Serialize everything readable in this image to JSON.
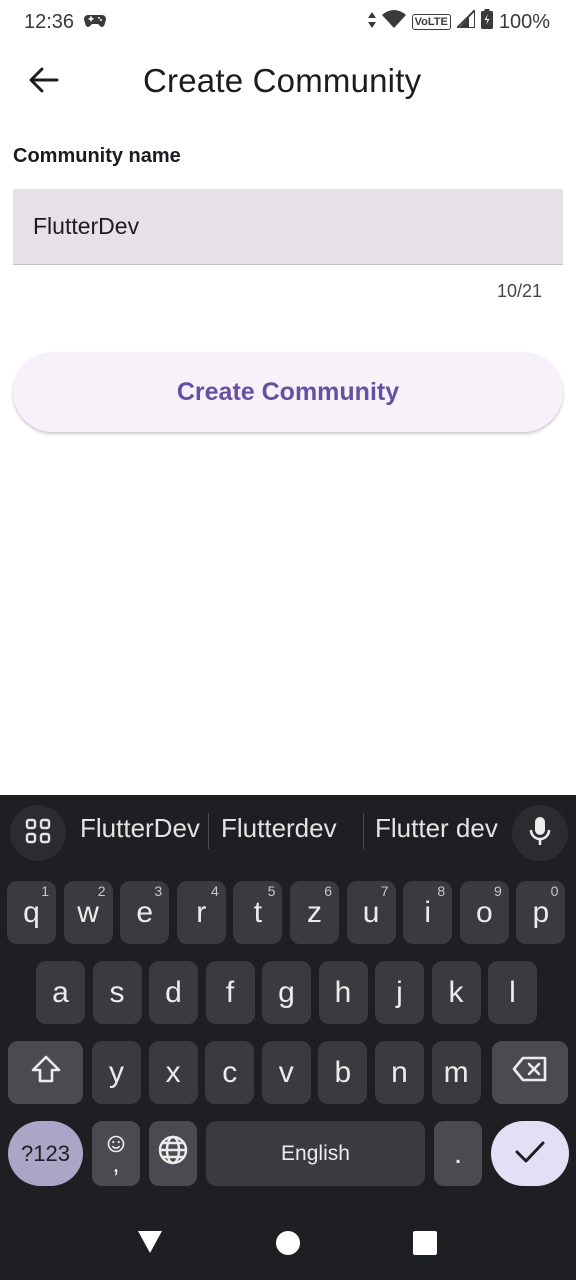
{
  "status_bar": {
    "time": "12:36",
    "volte": "VoLTE",
    "battery": "100%"
  },
  "app_bar": {
    "title": "Create Community",
    "back_icon": "arrow-left-icon"
  },
  "form": {
    "label": "Community name",
    "input_value": "FlutterDev",
    "counter": "10/21",
    "button_label": "Create Community"
  },
  "keyboard": {
    "suggestions": [
      "FlutterDev",
      "Flutterdev",
      "Flutter dev"
    ],
    "row1": [
      {
        "k": "q",
        "h": "1"
      },
      {
        "k": "w",
        "h": "2"
      },
      {
        "k": "e",
        "h": "3"
      },
      {
        "k": "r",
        "h": "4"
      },
      {
        "k": "t",
        "h": "5"
      },
      {
        "k": "z",
        "h": "6"
      },
      {
        "k": "u",
        "h": "7"
      },
      {
        "k": "i",
        "h": "8"
      },
      {
        "k": "o",
        "h": "9"
      },
      {
        "k": "p",
        "h": "0"
      }
    ],
    "row2": [
      "a",
      "s",
      "d",
      "f",
      "g",
      "h",
      "j",
      "k",
      "l"
    ],
    "row3": [
      "y",
      "x",
      "c",
      "v",
      "b",
      "n",
      "m"
    ],
    "sym_label": "?123",
    "emoji_comma": ",",
    "space_label": "English",
    "period_label": "."
  },
  "colors": {
    "accent": "#6750a4",
    "field_bg": "#e6e0e9",
    "keyboard_bg": "#1e1f23"
  }
}
